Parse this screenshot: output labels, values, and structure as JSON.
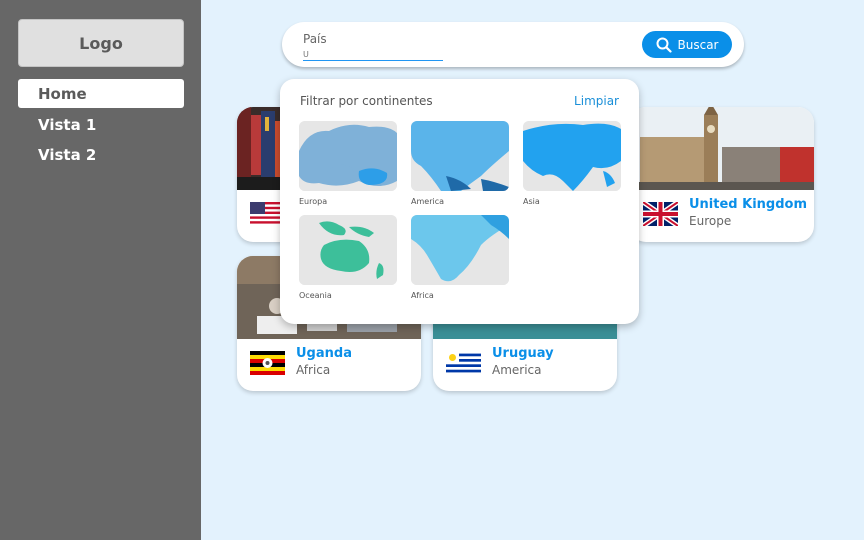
{
  "sidebar": {
    "logo": "Logo",
    "items": [
      {
        "label": "Home"
      },
      {
        "label": "Vista 1"
      },
      {
        "label": "Vista 2"
      }
    ]
  },
  "search": {
    "label": "País",
    "value": "",
    "placeholder": "U",
    "button_label": "Buscar"
  },
  "filter": {
    "title": "Filtrar por continentes",
    "clear_label": "Limpiar",
    "continents": [
      {
        "label": "Europa"
      },
      {
        "label": "America"
      },
      {
        "label": "Asia"
      },
      {
        "label": "Oceania"
      },
      {
        "label": "Africa"
      }
    ]
  },
  "cards": [
    {
      "name": "",
      "region": "",
      "flag": "us-flag"
    },
    {
      "name": "United Kingdom",
      "region": "Europe",
      "flag": "uk-flag"
    },
    {
      "name": "Uganda",
      "region": "Africa",
      "flag": "uganda-flag"
    },
    {
      "name": "Uruguay",
      "region": "America",
      "flag": "uruguay-flag"
    }
  ],
  "colors": {
    "sidebar": "#676767",
    "background": "#e3f2fd",
    "accent": "#0a8fe8"
  }
}
